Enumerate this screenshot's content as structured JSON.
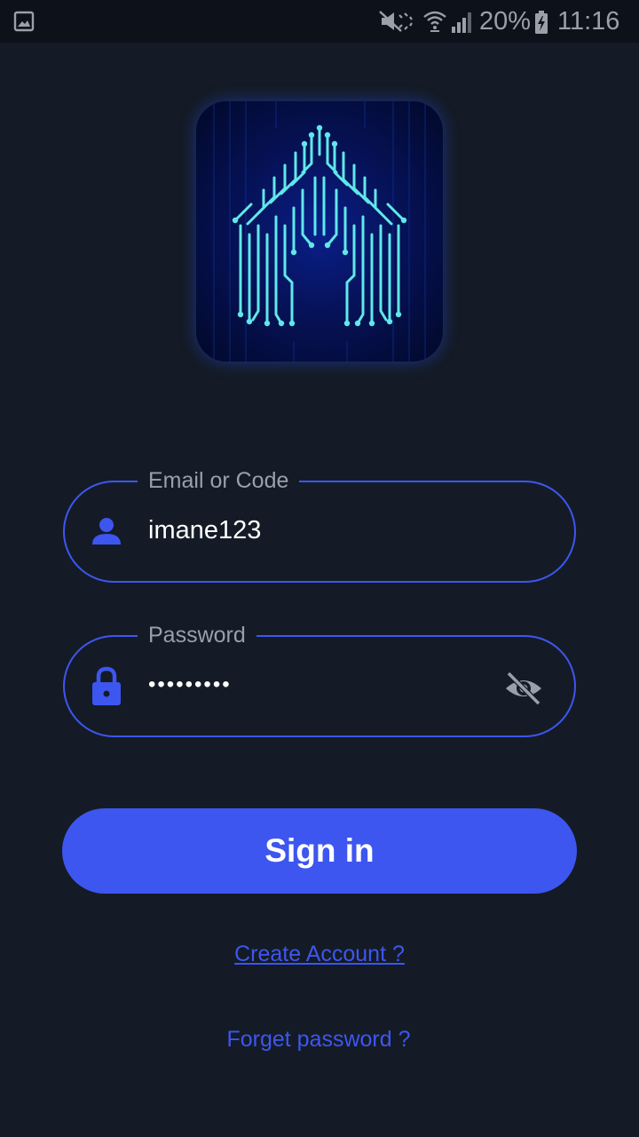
{
  "status_bar": {
    "battery": "20%",
    "time": "11:16",
    "icons": [
      "gallery-icon",
      "mute-icon",
      "wifi-icon",
      "signal-icon",
      "battery-charging-icon"
    ]
  },
  "logo": {
    "icon": "circuit-house-logo"
  },
  "form": {
    "email": {
      "label": "Email or Code",
      "value": "imane123",
      "icon": "person-icon"
    },
    "password": {
      "label": "Password",
      "value": "•••••••••",
      "icon": "lock-icon",
      "toggle_icon": "eye-off-icon"
    },
    "signin_label": "Sign in",
    "create_account_label": "Create Account ?",
    "forget_password_label": "Forget password ?"
  },
  "colors": {
    "background": "#141b26",
    "accent": "#3d56f0",
    "muted_text": "#9aa0aa"
  }
}
